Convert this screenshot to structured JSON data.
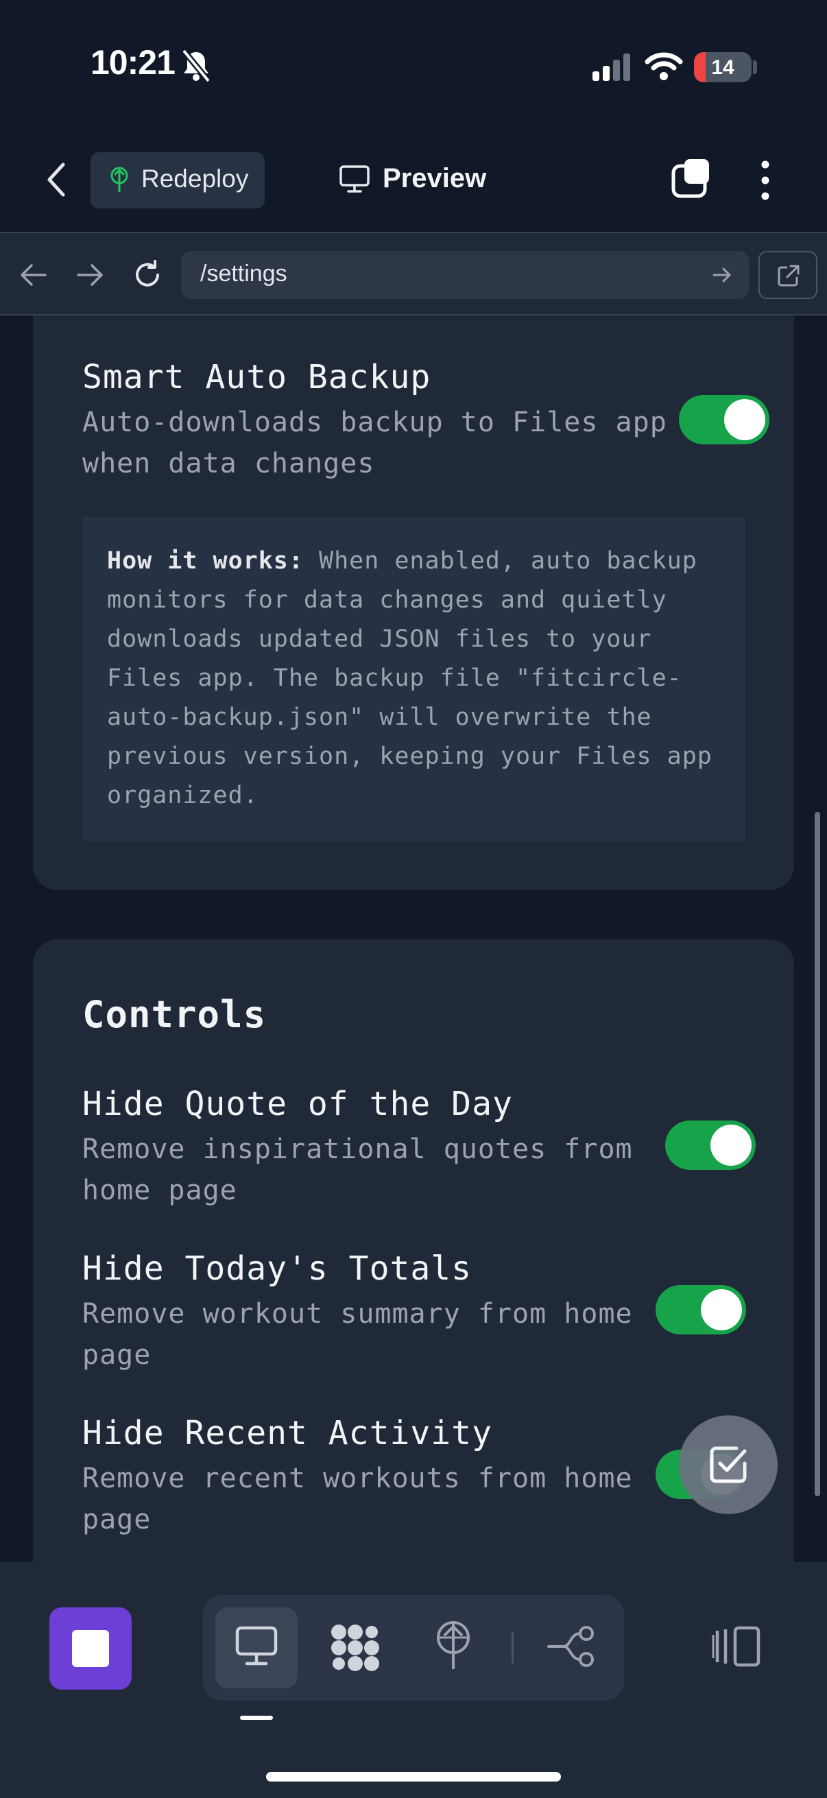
{
  "status_bar": {
    "time": "10:21",
    "battery_level": "14",
    "icons": [
      "bell-slash-icon",
      "cellular-signal-icon",
      "wifi-icon",
      "battery-icon"
    ]
  },
  "header": {
    "back_icon": "chevron-left-icon",
    "redeploy_label": "Redeploy",
    "preview_label": "Preview",
    "window_icon": "window-stack-icon",
    "menu_icon": "more-vertical-icon"
  },
  "url_bar": {
    "url": "/settings",
    "icons": [
      "arrow-left-icon",
      "arrow-right-icon",
      "reload-icon",
      "go-arrow-icon",
      "external-link-icon"
    ]
  },
  "smart_backup": {
    "title": "Smart Auto Backup",
    "description_line1": "Auto-downloads backup to Files app",
    "description_line2": "when data changes",
    "enabled": true,
    "info_label": "How it works:",
    "info_line1": " When enabled, auto backup",
    "info_line2": "monitors for data changes and quietly",
    "info_line3": "downloads updated JSON files to your",
    "info_line4": "Files app. The backup file \"fitcircle-",
    "info_line5": "auto-backup.json\" will overwrite the",
    "info_line6": "previous version, keeping your Files app",
    "info_line7": "organized."
  },
  "controls": {
    "title": "Controls",
    "items": [
      {
        "title": "Hide Quote of the Day",
        "description_line1": "Remove inspirational quotes from",
        "description_line2": "home page",
        "enabled": true
      },
      {
        "title": "Hide Today's Totals",
        "description_line1": "Remove workout summary from home",
        "description_line2": "page",
        "enabled": true
      },
      {
        "title": "Hide Recent Activity",
        "description_line1": "Remove recent workouts from home",
        "description_line2": "page",
        "enabled": true
      }
    ]
  },
  "bottom_toolbar": {
    "tools": [
      "monitor-icon",
      "apps-grid-icon",
      "deploy-tree-icon",
      "workflow-icon"
    ],
    "active_tool": "monitor-icon",
    "side_icons": [
      "stop-icon",
      "panel-layout-icon"
    ],
    "fab_icon": "checkbox-edit-icon"
  },
  "colors": {
    "background": "#111827",
    "card": "#1f2937",
    "toggle_on": "#16a34a",
    "accent_stop": "#6d3fd6",
    "battery_low": "#ef4444"
  }
}
